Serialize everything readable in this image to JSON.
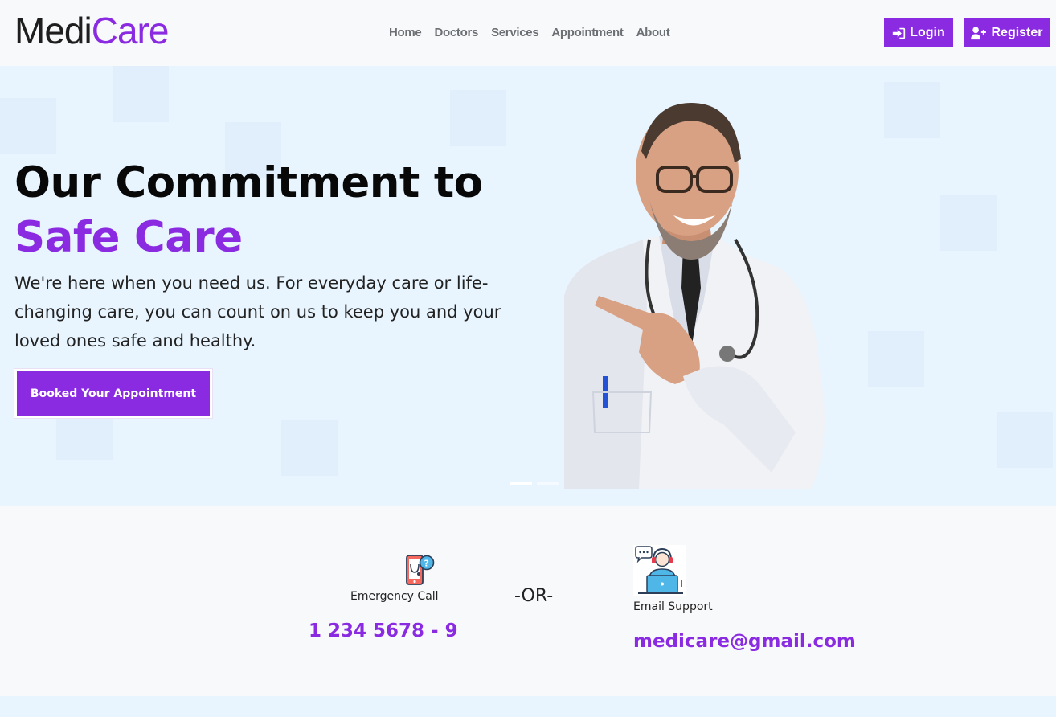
{
  "brand": {
    "part1": "Medi",
    "part2": "Care"
  },
  "nav": {
    "links": [
      "Home",
      "Doctors",
      "Services",
      "Appointment",
      "About"
    ]
  },
  "auth": {
    "login_label": "Login",
    "register_label": "Register"
  },
  "hero": {
    "title_line1": "Our Commitment to",
    "title_line2": "Safe Care",
    "description": "We're here when you need us. For everyday care or life-changing care, you can count on us to keep you and your loved ones safe and healthy.",
    "cta_label": "Booked Your Appointment"
  },
  "contact": {
    "emergency_label": "Emergency Call",
    "emergency_phone": "1 234 5678 - 9",
    "separator": "-OR-",
    "email_label": "Email Support",
    "email_address": "medicare@gmail.com"
  },
  "icons": {
    "login": "sign-in-icon",
    "register": "user-plus-icon",
    "emergency": "mobile-medical-call-icon",
    "email": "support-agent-laptop-icon"
  },
  "colors": {
    "accent": "#8a2be2",
    "hero_bg": "#e8f5fe",
    "page_bg": "#f8f9fb",
    "nav_text": "#6c6f73"
  }
}
